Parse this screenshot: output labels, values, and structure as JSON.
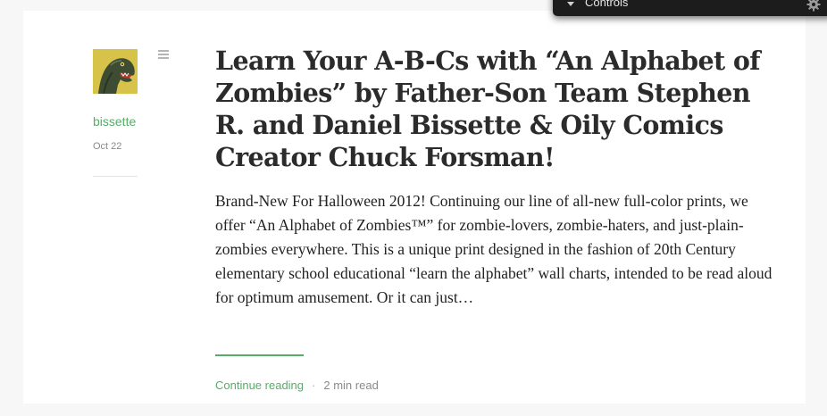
{
  "post": {
    "author": "bissette",
    "date": "Oct 22",
    "title": "Learn Your A-B-Cs with “An Alphabet of Zombies” by Father-Son Team Stephen R. and Daniel Bissette & Oily Comics Creator Chuck Forsman!",
    "excerpt": "Brand-New For Halloween 2012! Continuing our line of all-new full-color prints, we offer “An Alphabet of Zombies™” for zombie-lovers, zombie-haters, and just-plain-zombies everywhere. This is a unique print designed in the fashion of 20th Century elementary school educational “learn the alphabet” wall charts, intended to be read aloud for optimum amusement. Or it can just…",
    "continue_label": "Continue reading",
    "separator": "·",
    "read_time": "2 min read"
  },
  "controls": {
    "label": "Controls"
  },
  "icons": {
    "menu": "hamburger-menu-icon",
    "avatar": "dinosaur-avatar-image",
    "controls_toggle": "triangle-down-icon",
    "settings": "gear-icon"
  },
  "colors": {
    "accent": "#57ad68",
    "title": "#2b2b2b",
    "meta": "#8a8a8a",
    "controls_bg": "#1c1c1c"
  }
}
